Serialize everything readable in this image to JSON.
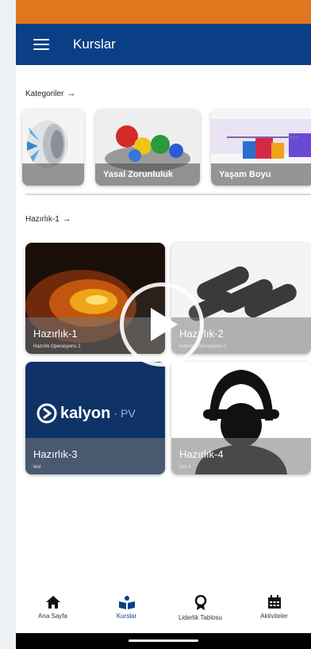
{
  "header": {
    "title": "Kurslar"
  },
  "sections": {
    "categories_title": "Kategoriler",
    "courses_title": "Hazırlık-1"
  },
  "categories": [
    {
      "label": ""
    },
    {
      "label": "Yasal Zorunluluk"
    },
    {
      "label": "Yaşam Boyu"
    }
  ],
  "courses": [
    {
      "title": "Hazırlık-1",
      "subtitle": "Hazırlık Operasyonu 1"
    },
    {
      "title": "Hazırlık-2",
      "subtitle": "Hazırlık Operasyonu 2"
    },
    {
      "title": "Hazırlık-3",
      "subtitle": "test",
      "brand": "kalyon",
      "brand_suffix": "PV"
    },
    {
      "title": "Hazırlık-4",
      "subtitle": "test 4"
    }
  ],
  "nav": [
    {
      "label": "Ana Sayfa",
      "icon": "home-icon"
    },
    {
      "label": "Kurslar",
      "icon": "courses-icon",
      "active": true
    },
    {
      "label": "Liderlik Tablosu",
      "icon": "award-icon"
    },
    {
      "label": "Aktiviteler",
      "icon": "calendar-icon"
    }
  ],
  "colors": {
    "app_bar": "#0a3f86",
    "status_strip": "#e2761f",
    "kalyon_bg": "#0f3366"
  }
}
